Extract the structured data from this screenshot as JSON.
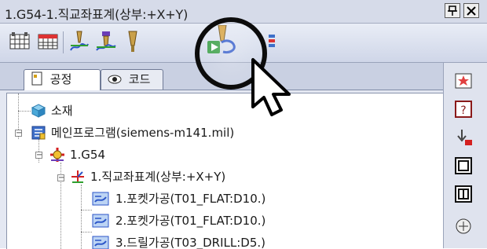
{
  "window": {
    "title": "1.G54-1.직교좌표계(상부:+X+Y)",
    "buttons": {
      "pin": "📌",
      "close": "✕"
    }
  },
  "toolbar": {
    "icons": [
      "grid-view-icon",
      "calendar-table-icon",
      "toolpath-tool-icon",
      "multi-tool-icon",
      "tool-holder-icon",
      "simulate-toolpath-icon",
      "more-tools-icon"
    ]
  },
  "tabs": [
    {
      "label": "공정",
      "icon": "process-icon",
      "active": true
    },
    {
      "label": "코드",
      "icon": "eye-icon",
      "active": false
    }
  ],
  "tree": {
    "items": [
      {
        "label": "소재",
        "icon": "stock-cube-icon"
      },
      {
        "label": "메인프로그램(siemens-m141.mil)",
        "icon": "main-program-icon"
      },
      {
        "label": "1.G54",
        "icon": "work-offset-icon"
      },
      {
        "label": "1.직교좌표계(상부:+X+Y)",
        "icon": "coordinate-system-icon"
      },
      {
        "label": "1.포켓가공(T01_FLAT:D10.)",
        "icon": "operation-icon"
      },
      {
        "label": "2.포켓가공(T01_FLAT:D10.)",
        "icon": "operation-icon"
      },
      {
        "label": "3.드릴가공(T03_DRILL:D5.)",
        "icon": "operation-icon"
      }
    ]
  },
  "sidebar": {
    "icons": [
      "star-folder-icon",
      "help-doc-icon",
      "arrow-down-tool-icon",
      "frame-view-icon",
      "frame-edit-icon",
      "tool-library-icon"
    ]
  },
  "colors": {
    "titlebar": "#d6dbe9",
    "toolbar": "#cfd6e8",
    "tree_bg": "#ffffff",
    "accent_blue": "#3d6fc9"
  }
}
